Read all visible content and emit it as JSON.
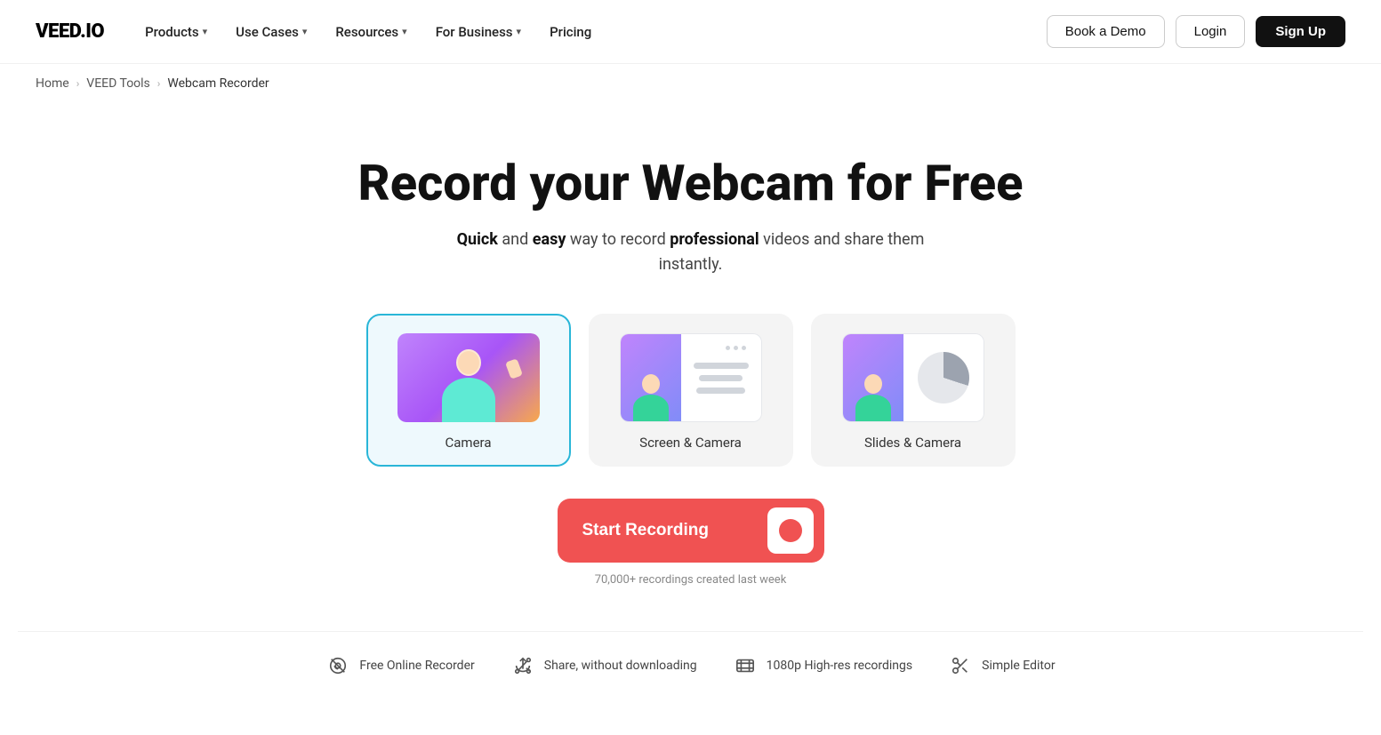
{
  "brand": {
    "logo": "VEED.IO"
  },
  "nav": {
    "items": [
      {
        "label": "Products",
        "hasDropdown": true
      },
      {
        "label": "Use Cases",
        "hasDropdown": true
      },
      {
        "label": "Resources",
        "hasDropdown": true
      },
      {
        "label": "For Business",
        "hasDropdown": true
      },
      {
        "label": "Pricing",
        "hasDropdown": false
      }
    ],
    "book_demo": "Book a Demo",
    "login": "Login",
    "signup": "Sign Up"
  },
  "breadcrumb": {
    "home": "Home",
    "tools": "VEED Tools",
    "current": "Webcam Recorder"
  },
  "hero": {
    "title": "Record your Webcam for Free",
    "subtitle_prefix": "",
    "subtitle": "and easy way to record  videos and share them instantly.",
    "subtitle_quick": "Quick",
    "subtitle_easy": "easy",
    "subtitle_professional": "professional"
  },
  "modes": [
    {
      "id": "camera",
      "label": "Camera",
      "active": true
    },
    {
      "id": "screen-camera",
      "label": "Screen & Camera",
      "active": false
    },
    {
      "id": "slides-camera",
      "label": "Slides & Camera",
      "active": false
    }
  ],
  "cta": {
    "start_label": "Start Recording",
    "recordings_count": "70,000+ recordings created last week"
  },
  "features": [
    {
      "icon": "no-camera-icon",
      "label": "Free Online Recorder"
    },
    {
      "icon": "share-icon",
      "label": "Share, without downloading"
    },
    {
      "icon": "film-icon",
      "label": "1080p High-res recordings"
    },
    {
      "icon": "scissors-icon",
      "label": "Simple Editor"
    }
  ]
}
